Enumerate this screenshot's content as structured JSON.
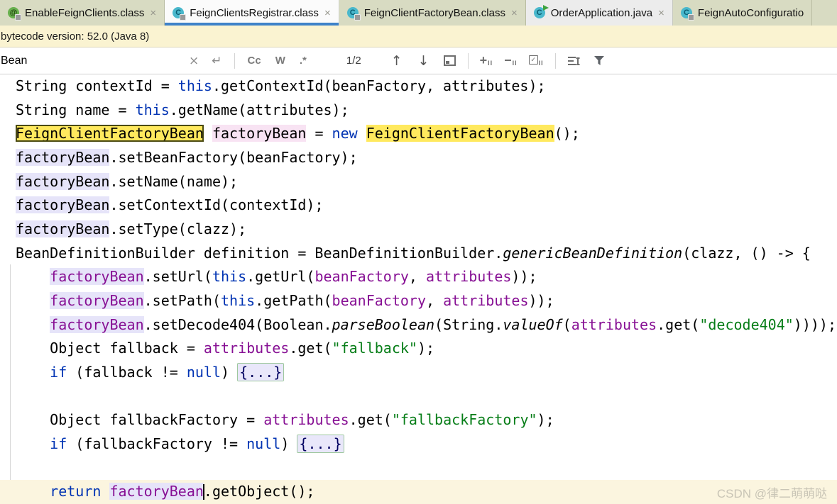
{
  "tabs": [
    {
      "label": "EnableFeignClients.class",
      "letter": "@",
      "icon": "annotation-icon",
      "badge": "lock",
      "tint": "green",
      "active": false,
      "close_label": "×"
    },
    {
      "label": "FeignClientsRegistrar.class",
      "letter": "C",
      "icon": "class-icon",
      "badge": "lock",
      "tint": "white",
      "active": true,
      "close_label": "×"
    },
    {
      "label": "FeignClientFactoryBean.class",
      "letter": "C",
      "icon": "class-icon",
      "badge": "lock",
      "tint": "green",
      "active": false,
      "close_label": "×"
    },
    {
      "label": "OrderApplication.java",
      "letter": "C",
      "icon": "class-run-icon",
      "badge": "run",
      "tint": "gray",
      "active": false,
      "close_label": "×"
    },
    {
      "label": "FeignAutoConfiguratio",
      "letter": "C",
      "icon": "class-icon",
      "badge": "lock",
      "tint": "green",
      "active": false,
      "close_label": null
    }
  ],
  "notification": {
    "text": "bytecode version: 52.0 (Java 8)"
  },
  "search": {
    "query": "Bean",
    "clear_icon": "×",
    "newline_icon": "↵",
    "match_case_label": "Cc",
    "words_label": "W",
    "regex_label": ".*",
    "counter": "1/2",
    "prev_icon": "↑",
    "next_icon": "↓",
    "add_occurrence_glyph": "+",
    "remove_occurrence_glyph": "−",
    "select_all_check_glyph": "✓",
    "occurrence_suffix": "II"
  },
  "colors": {
    "active_tab_underline": "#3e82c9",
    "inactive_tab_bg": "#d8dbc2",
    "notification_bg": "#faf3d1",
    "match_yellow": "#ffe95e",
    "keyword_blue": "#0033b3",
    "string_green": "#067d17",
    "identifier_purple": "#871094",
    "current_line_bg": "#fbf5df"
  },
  "watermark": "CSDN @律二萌萌哒",
  "code": {
    "current_line": 18,
    "lines": [
      [
        {
          "t": "String contextId = "
        },
        {
          "t": "this",
          "s": "k"
        },
        {
          "t": ".getContextId(beanFactory, attributes);"
        }
      ],
      [
        {
          "t": "String name = "
        },
        {
          "t": "this",
          "s": "k"
        },
        {
          "t": ".getName(attributes);"
        }
      ],
      [
        {
          "t": "FeignClientFactoryBean",
          "s": "mYc"
        },
        {
          "t": " "
        },
        {
          "t": "factoryBean",
          "s": "mPink"
        },
        {
          "t": " = "
        },
        {
          "t": "new",
          "s": "k"
        },
        {
          "t": " "
        },
        {
          "t": "FeignClientFactoryBean",
          "s": "mY"
        },
        {
          "t": "();"
        }
      ],
      [
        {
          "t": "factoryBean",
          "s": "mLav"
        },
        {
          "t": ".setBeanFactory(beanFactory);"
        }
      ],
      [
        {
          "t": "factoryBean",
          "s": "mLav"
        },
        {
          "t": ".setName(name);"
        }
      ],
      [
        {
          "t": "factoryBean",
          "s": "mLav"
        },
        {
          "t": ".setContextId(contextId);"
        }
      ],
      [
        {
          "t": "factoryBean",
          "s": "mLav"
        },
        {
          "t": ".setType(clazz);"
        }
      ],
      [
        {
          "t": "BeanDefinitionBuilder definition = BeanDefinitionBuilder."
        },
        {
          "t": "genericBeanDefinition",
          "s": "i"
        },
        {
          "t": "(clazz, () -> {"
        }
      ],
      [
        {
          "t": "    "
        },
        {
          "t": "factoryBean",
          "s": "p mLav"
        },
        {
          "t": ".setUrl("
        },
        {
          "t": "this",
          "s": "k"
        },
        {
          "t": ".getUrl("
        },
        {
          "t": "beanFactory",
          "s": "p"
        },
        {
          "t": ", "
        },
        {
          "t": "attributes",
          "s": "p"
        },
        {
          "t": "));"
        }
      ],
      [
        {
          "t": "    "
        },
        {
          "t": "factoryBean",
          "s": "p mLav"
        },
        {
          "t": ".setPath("
        },
        {
          "t": "this",
          "s": "k"
        },
        {
          "t": ".getPath("
        },
        {
          "t": "beanFactory",
          "s": "p"
        },
        {
          "t": ", "
        },
        {
          "t": "attributes",
          "s": "p"
        },
        {
          "t": "));"
        }
      ],
      [
        {
          "t": "    "
        },
        {
          "t": "factoryBean",
          "s": "p mLav"
        },
        {
          "t": ".setDecode404(Boolean."
        },
        {
          "t": "parseBoolean",
          "s": "i"
        },
        {
          "t": "(String."
        },
        {
          "t": "valueOf",
          "s": "i"
        },
        {
          "t": "("
        },
        {
          "t": "attributes",
          "s": "p"
        },
        {
          "t": ".get("
        },
        {
          "t": "\"decode404\"",
          "s": "s"
        },
        {
          "t": "))));"
        }
      ],
      [
        {
          "t": "    Object fallback = "
        },
        {
          "t": "attributes",
          "s": "p"
        },
        {
          "t": ".get("
        },
        {
          "t": "\"fallback\"",
          "s": "s"
        },
        {
          "t": ");"
        }
      ],
      [
        {
          "t": "    "
        },
        {
          "t": "if",
          "s": "k"
        },
        {
          "t": " (fallback != "
        },
        {
          "t": "null",
          "s": "k"
        },
        {
          "t": ") "
        },
        {
          "t": "{...}",
          "s": "fold"
        }
      ],
      [],
      [
        {
          "t": "    Object fallbackFactory = "
        },
        {
          "t": "attributes",
          "s": "p"
        },
        {
          "t": ".get("
        },
        {
          "t": "\"fallbackFactory\"",
          "s": "s"
        },
        {
          "t": ");"
        }
      ],
      [
        {
          "t": "    "
        },
        {
          "t": "if",
          "s": "k"
        },
        {
          "t": " (fallbackFactory != "
        },
        {
          "t": "null",
          "s": "k"
        },
        {
          "t": ") "
        },
        {
          "t": "{...}",
          "s": "fold"
        }
      ],
      [],
      [
        {
          "t": "    "
        },
        {
          "t": "return",
          "s": "k"
        },
        {
          "t": " "
        },
        {
          "t": "factoryBean",
          "s": "p mLav"
        },
        {
          "t": "",
          "s": "caret"
        },
        {
          "t": ".getObject();"
        }
      ]
    ]
  }
}
